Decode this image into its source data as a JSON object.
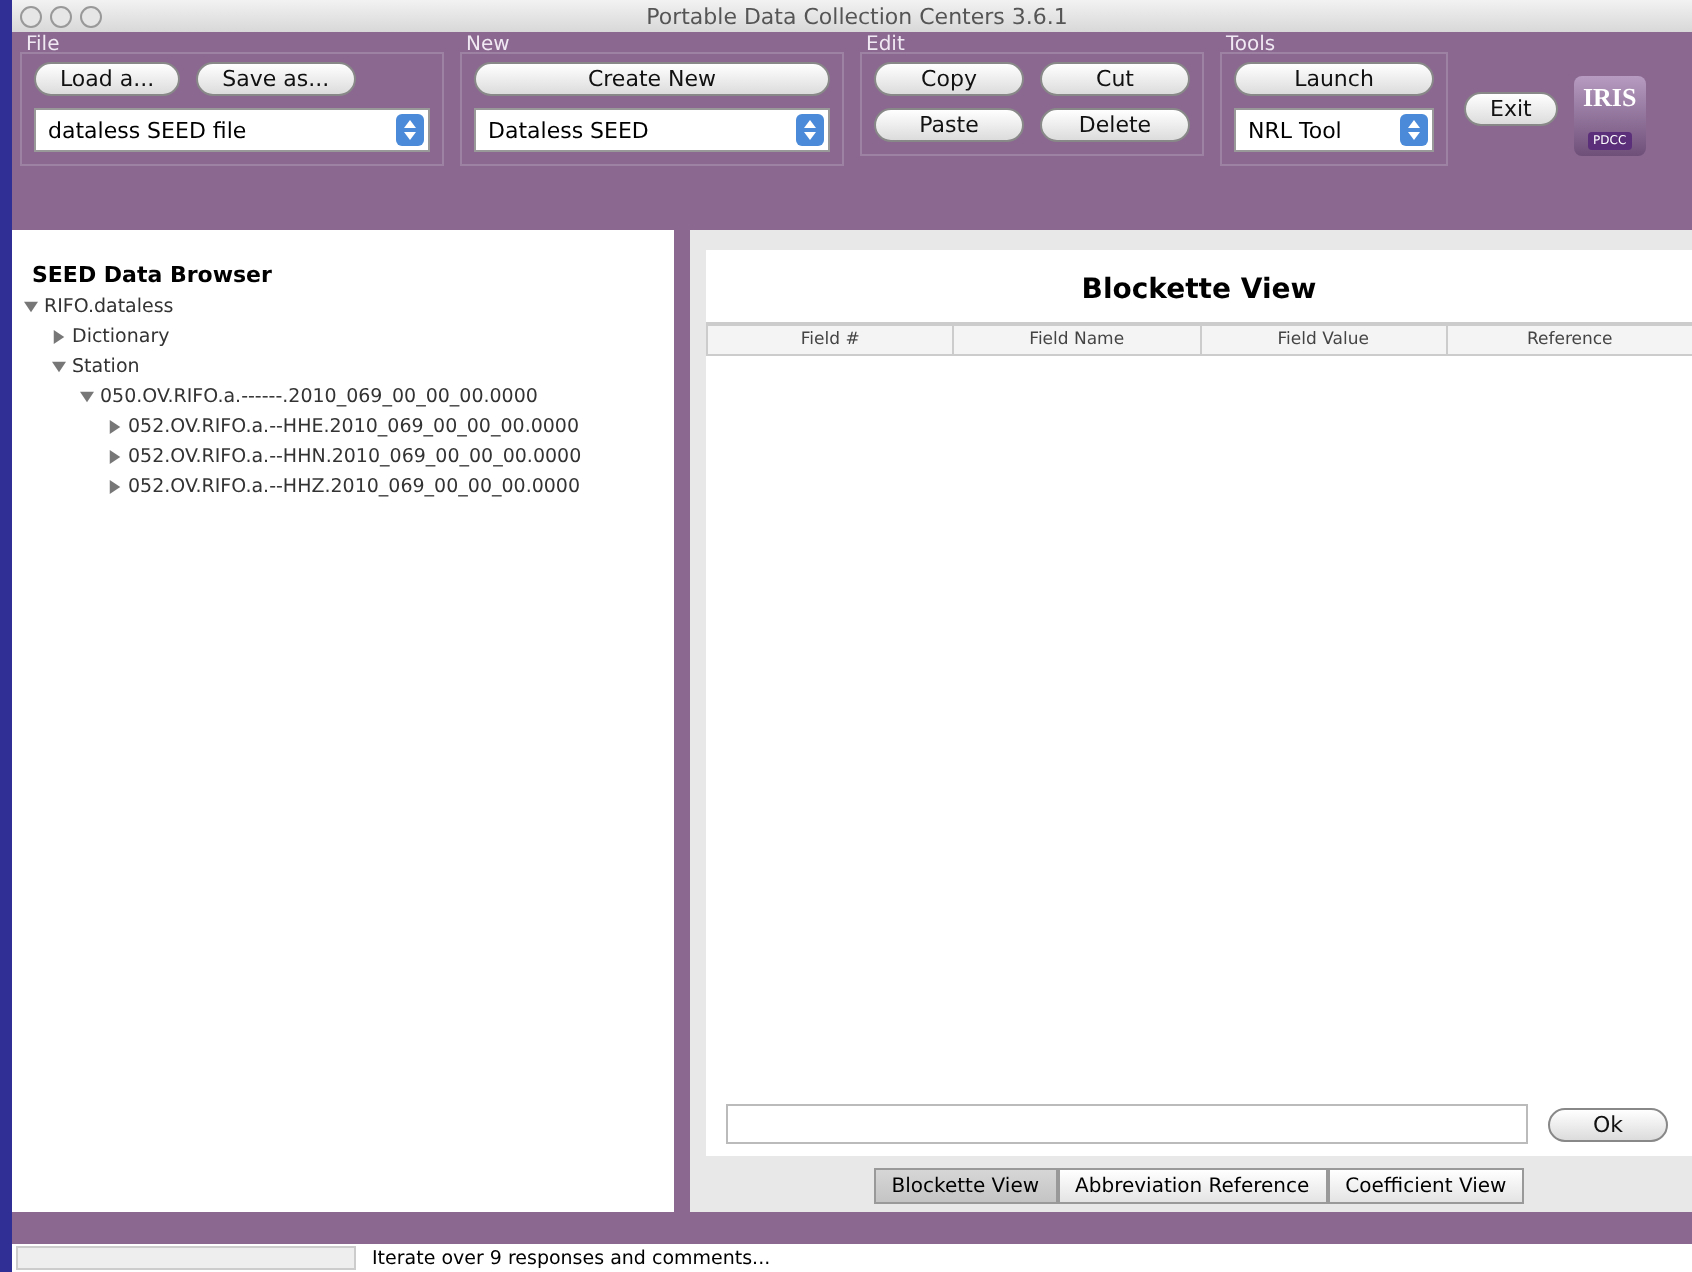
{
  "window": {
    "title": "Portable Data Collection Centers 3.6.1"
  },
  "toolbar": {
    "groups": [
      {
        "label": "File",
        "buttons": [
          "Load a...",
          "Save as..."
        ],
        "select": "dataless SEED file"
      },
      {
        "label": "New",
        "buttons": [
          "Create New"
        ],
        "select": "Dataless SEED"
      },
      {
        "label": "Edit",
        "buttons": [
          "Copy",
          "Cut",
          "Paste",
          "Delete"
        ]
      },
      {
        "label": "Tools",
        "buttons": [
          "Launch"
        ],
        "select": "NRL Tool"
      }
    ],
    "exit": "Exit",
    "logo": {
      "text": "IRIS",
      "badge": "PDCC"
    }
  },
  "browser": {
    "title": "SEED Data Browser",
    "tree": [
      {
        "label": "RIFO.dataless",
        "expanded": true,
        "children": [
          {
            "label": "Dictionary",
            "expanded": false
          },
          {
            "label": "Station",
            "expanded": true,
            "children": [
              {
                "label": "050.OV.RIFO.a.------.2010_069_00_00_00.0000",
                "expanded": true,
                "children": [
                  {
                    "label": "052.OV.RIFO.a.--HHE.2010_069_00_00_00.0000",
                    "expanded": false
                  },
                  {
                    "label": "052.OV.RIFO.a.--HHN.2010_069_00_00_00.0000",
                    "expanded": false
                  },
                  {
                    "label": "052.OV.RIFO.a.--HHZ.2010_069_00_00_00.0000",
                    "expanded": false
                  }
                ]
              }
            ]
          }
        ]
      }
    ]
  },
  "view": {
    "title": "Blockette View",
    "columns": [
      "Field #",
      "Field Name",
      "Field Value",
      "Reference"
    ],
    "ok": "Ok",
    "tabs": [
      {
        "label": "Blockette View",
        "selected": true
      },
      {
        "label": "Abbreviation Reference",
        "selected": false
      },
      {
        "label": "Coefficient View",
        "selected": false
      }
    ]
  },
  "status_bar": {
    "message": "Iterate over 9 responses and comments..."
  }
}
